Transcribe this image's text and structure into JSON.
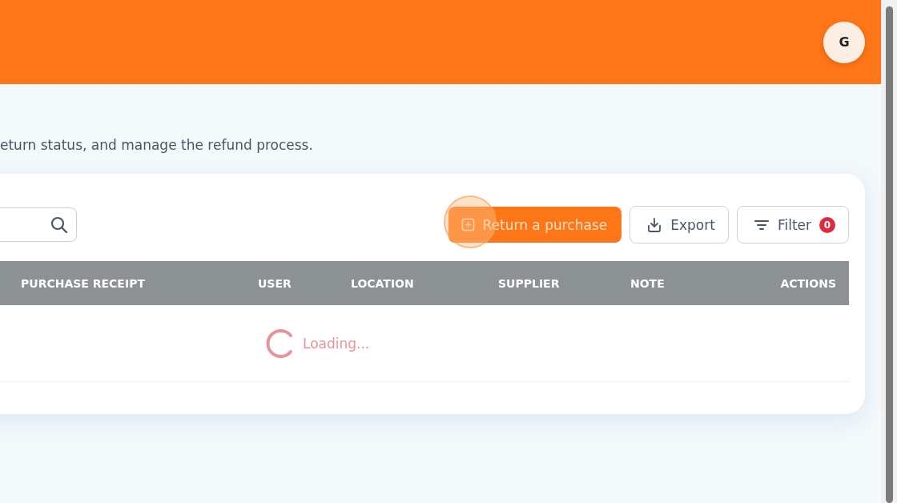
{
  "header": {
    "avatar": "G"
  },
  "subtitle": "eturn status, and manage the refund process.",
  "toolbar": {
    "buttons": [
      {
        "kind": "primary",
        "label": "Return a purchase",
        "highlighted": true
      },
      {
        "kind": "export",
        "label": "Export"
      },
      {
        "kind": "filter",
        "label": "Filter",
        "badge": "0"
      }
    ]
  },
  "table": {
    "columns": [
      "PURCHASE RECEIPT",
      "USER",
      "LOCATION",
      "SUPPLIER",
      "NOTE",
      "ACTIONS"
    ],
    "loading": "Loading..."
  }
}
